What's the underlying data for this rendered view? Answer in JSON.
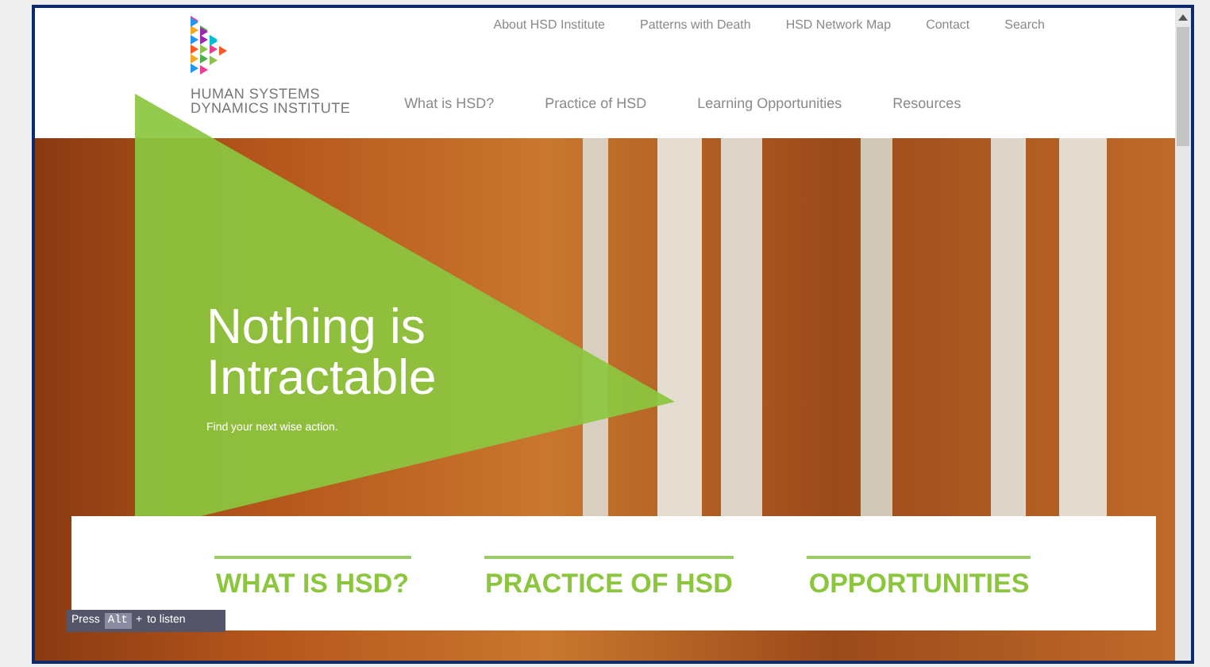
{
  "brand": {
    "line1": "HUMAN SYSTEMS",
    "line2": "DYNAMICS INSTITUTE"
  },
  "top_links": [
    "About HSD Institute",
    "Patterns with Death",
    "HSD Network Map",
    "Contact",
    "Search"
  ],
  "main_nav": [
    "What is HSD?",
    "Practice of HSD",
    "Learning Opportunities",
    "Resources"
  ],
  "hero": {
    "title_line1": "Nothing is",
    "title_line2": "Intractable",
    "subtitle": "Find your next wise action."
  },
  "feature_links": [
    "WHAT IS HSD?",
    "PRACTICE OF HSD",
    "OPPORTUNITIES"
  ],
  "listen_bar": {
    "prefix": "Press",
    "key": "Alt",
    "plus": "+",
    "suffix": "to listen"
  }
}
